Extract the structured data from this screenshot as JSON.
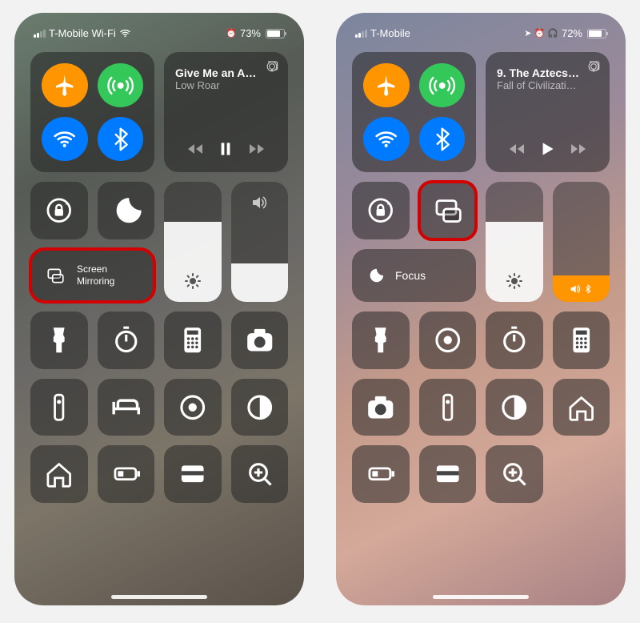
{
  "left": {
    "status": {
      "carrier": "T-Mobile Wi-Fi",
      "battery_pct": "73%",
      "battery_fill": 73,
      "alarm": "⏰"
    },
    "music": {
      "title": "Give Me an A…",
      "subtitle": "Low Roar",
      "state": "paused"
    },
    "screen_mirroring": {
      "label1": "Screen",
      "label2": "Mirroring"
    },
    "brightness": 0.55,
    "volume": 0.35,
    "highlight": "screen-mirroring"
  },
  "right": {
    "status": {
      "carrier": "T-Mobile",
      "battery_pct": "72%",
      "battery_fill": 72,
      "icons": "◤ ⏰ 🎧"
    },
    "music": {
      "title": "9. The Aztecs…",
      "subtitle": "Fall of Civilizati…",
      "state": "playing"
    },
    "focus": {
      "label": "Focus"
    },
    "brightness": 0.55,
    "volume": 0.18,
    "highlight": "screen-mirroring"
  }
}
